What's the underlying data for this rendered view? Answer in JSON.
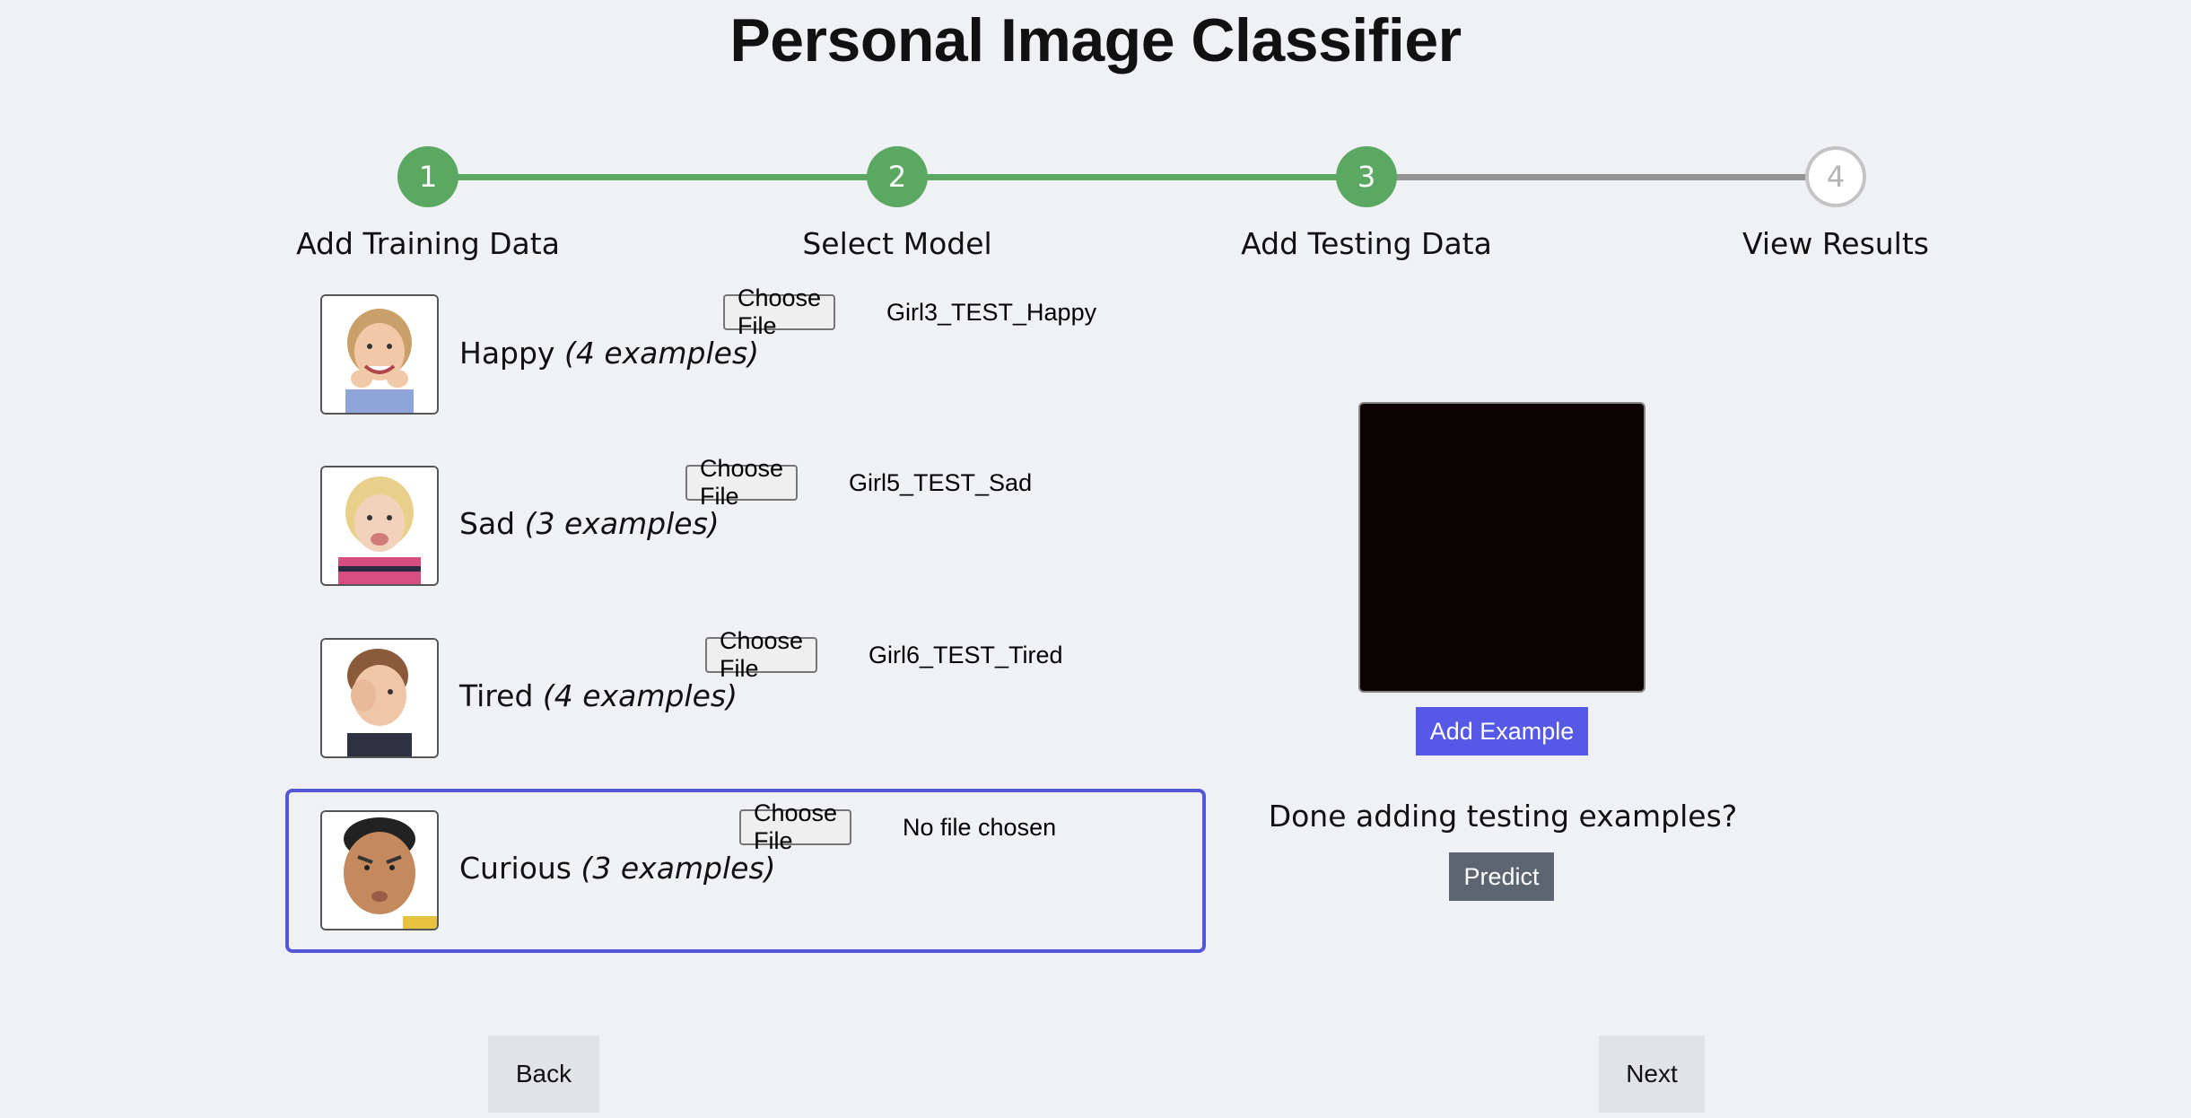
{
  "header": {
    "title": "Personal Image Classifier"
  },
  "steps": [
    {
      "number": "1",
      "label": "Add Training Data"
    },
    {
      "number": "2",
      "label": "Select Model"
    },
    {
      "number": "3",
      "label": "Add Testing Data"
    },
    {
      "number": "4",
      "label": "View Results"
    }
  ],
  "categories": [
    {
      "name": "Happy",
      "examples": "(4 examples)",
      "button": "Choose File",
      "file": "Girl3_TEST_Happy"
    },
    {
      "name": "Sad",
      "examples": "(3 examples)",
      "button": "Choose File",
      "file": "Girl5_TEST_Sad"
    },
    {
      "name": "Tired",
      "examples": "(4 examples)",
      "button": "Choose File",
      "file": "Girl6_TEST_Tired"
    },
    {
      "name": "Curious",
      "examples": "(3 examples)",
      "button": "Choose File",
      "file": "No file chosen"
    }
  ],
  "panel": {
    "add_example_label": "Add Example",
    "done_text": "Done adding testing examples?",
    "predict_label": "Predict"
  },
  "nav": {
    "back_label": "Back",
    "next_label": "Next"
  },
  "colors": {
    "step_done": "#5aa862",
    "accent": "#5659e6",
    "predict": "#5d6570"
  }
}
